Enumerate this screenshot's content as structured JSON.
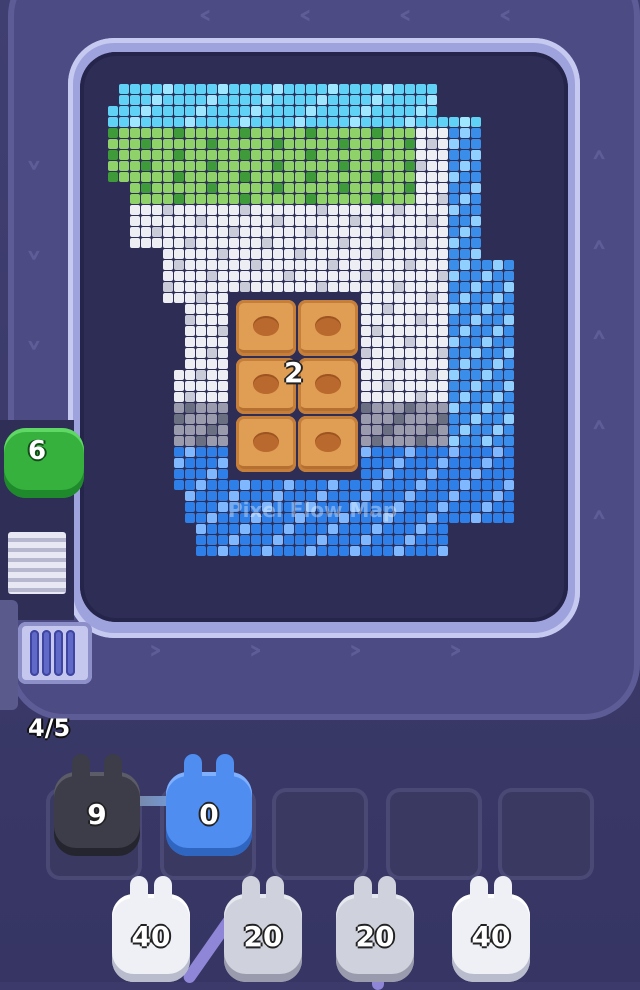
{
  "board": {
    "crate_count": "2",
    "watermark": "Pixel Flow Map"
  },
  "queue": {
    "green_shooter": "6",
    "progress": "4/5"
  },
  "slots": [
    {
      "value": "9",
      "color": "#3c3d48"
    },
    {
      "value": "0",
      "color": "#4f8df0"
    },
    {
      "value": "",
      "color": ""
    },
    {
      "value": "",
      "color": ""
    },
    {
      "value": "",
      "color": ""
    }
  ],
  "shooters": [
    {
      "value": "40",
      "color": "#eef0f6"
    },
    {
      "value": "20",
      "color": "#cfd1dc"
    },
    {
      "value": "20",
      "color": "#cfd1dc"
    },
    {
      "value": "40",
      "color": "#eef0f6"
    }
  ],
  "colors": {
    "background": "#3b3a6b",
    "rail": "#9fa3dd",
    "crate": "#e09d54",
    "sky_blue": "#5fd2f5",
    "water_blue": "#2f7fe8",
    "grass_green": "#8fd26a",
    "rock_white": "#eceef4",
    "rock_gray": "#9a9cad"
  },
  "icons": [
    "chevron-icon",
    "spool-icon",
    "stairs-icon",
    "crate-icon",
    "bunny-shooter-icon"
  ]
}
